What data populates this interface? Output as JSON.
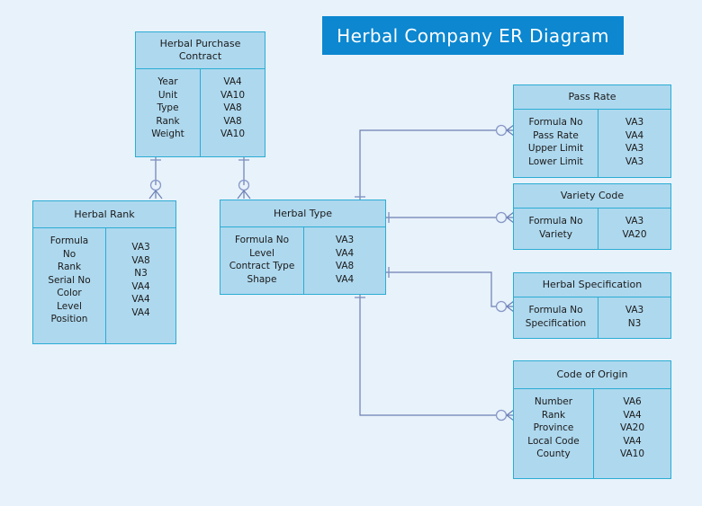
{
  "title": {
    "text": "Herbal Company ER Diagram",
    "banner_color": "#0c87d0",
    "text_color": "#ffffff"
  },
  "theme": {
    "background": "#e8f2fa",
    "entity_fill": "#aed8ee",
    "entity_border": "#2badd4",
    "connector_color": "#6b7fb5"
  },
  "entities": [
    {
      "id": "herbal-purchase-contract",
      "name": "Herbal Purchase Contract",
      "fields": [
        {
          "name": "Year",
          "type": "VA4"
        },
        {
          "name": "Unit",
          "type": "VA10"
        },
        {
          "name": "Type",
          "type": "VA8"
        },
        {
          "name": "Rank",
          "type": "VA8"
        },
        {
          "name": "Weight",
          "type": "VA10"
        }
      ]
    },
    {
      "id": "herbal-rank",
      "name": "Herbal Rank",
      "fields": [
        {
          "name": "Formula No",
          "type": "VA3"
        },
        {
          "name": "Rank",
          "type": "VA8"
        },
        {
          "name": "Serial No",
          "type": "N3"
        },
        {
          "name": "Color",
          "type": "VA4"
        },
        {
          "name": "Level",
          "type": "VA4"
        },
        {
          "name": "Position",
          "type": "VA4"
        }
      ]
    },
    {
      "id": "herbal-type",
      "name": "Herbal Type",
      "fields": [
        {
          "name": "Formula No",
          "type": "VA3"
        },
        {
          "name": "Level",
          "type": "VA4"
        },
        {
          "name": "Contract Type",
          "type": "VA8"
        },
        {
          "name": "Shape",
          "type": "VA4"
        }
      ]
    },
    {
      "id": "pass-rate",
      "name": "Pass Rate",
      "fields": [
        {
          "name": "Formula No",
          "type": "VA3"
        },
        {
          "name": "Pass Rate",
          "type": "VA4"
        },
        {
          "name": "Upper Limit",
          "type": "VA3"
        },
        {
          "name": "Lower Limit",
          "type": "VA3"
        }
      ]
    },
    {
      "id": "variety-code",
      "name": "Variety Code",
      "fields": [
        {
          "name": "Formula No",
          "type": "VA3"
        },
        {
          "name": "Variety",
          "type": "VA20"
        }
      ]
    },
    {
      "id": "herbal-specification",
      "name": "Herbal Specification",
      "fields": [
        {
          "name": "Formula No",
          "type": "VA3"
        },
        {
          "name": "Specification",
          "type": "N3"
        }
      ]
    },
    {
      "id": "code-of-origin",
      "name": "Code of Origin",
      "fields": [
        {
          "name": "Number",
          "type": "VA6"
        },
        {
          "name": "Rank",
          "type": "VA4"
        },
        {
          "name": "Province",
          "type": "VA20"
        },
        {
          "name": "Local Code",
          "type": "VA4"
        },
        {
          "name": "County",
          "type": "VA10"
        }
      ]
    }
  ],
  "relationships": [
    {
      "from": "herbal-purchase-contract",
      "to": "herbal-rank",
      "from_cardinality": "one",
      "to_cardinality": "zero-or-many"
    },
    {
      "from": "herbal-purchase-contract",
      "to": "herbal-type",
      "from_cardinality": "one",
      "to_cardinality": "zero-or-many"
    },
    {
      "from": "herbal-type",
      "to": "pass-rate",
      "from_cardinality": "one",
      "to_cardinality": "zero-or-many"
    },
    {
      "from": "herbal-type",
      "to": "variety-code",
      "from_cardinality": "one",
      "to_cardinality": "zero-or-many"
    },
    {
      "from": "herbal-type",
      "to": "herbal-specification",
      "from_cardinality": "one",
      "to_cardinality": "zero-or-many"
    },
    {
      "from": "herbal-type",
      "to": "code-of-origin",
      "from_cardinality": "one",
      "to_cardinality": "zero-or-many"
    }
  ]
}
